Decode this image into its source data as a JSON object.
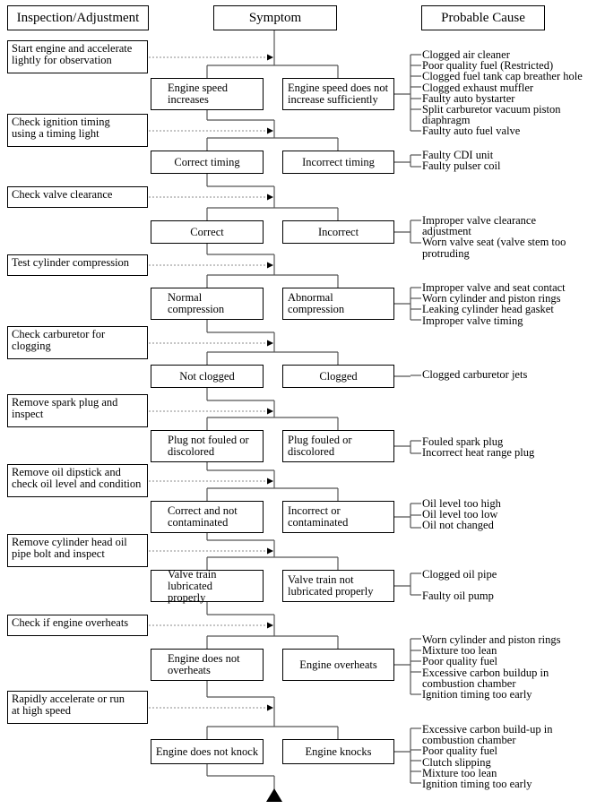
{
  "headers": {
    "inspection": "Inspection/Adjustment",
    "symptom": "Symptom",
    "cause": "Probable Cause"
  },
  "steps": [
    {
      "inspection": "Start engine and accelerate\nlightly for observation",
      "ok": "Engine speed\nincreases",
      "fault": "Engine speed does not\nincrease sufficiently",
      "causes": [
        "Clogged air cleaner",
        "Poor quality fuel (Restricted)",
        "Clogged fuel tank cap breather hole",
        "Clogged exhaust muffler",
        "Faulty auto bystarter",
        "Split carburetor vacuum piston\ndiaphragm",
        "Faulty auto fuel valve"
      ]
    },
    {
      "inspection": "Check ignition timing\nusing a timing light",
      "ok": "Correct timing",
      "fault": "Incorrect timing",
      "causes": [
        "Faulty CDI unit",
        "Faulty pulser coil"
      ]
    },
    {
      "inspection": "Check valve clearance",
      "ok": "Correct",
      "fault": "Incorrect",
      "causes": [
        "Improper valve clearance\nadjustment",
        "Worn valve seat (valve stem too\nprotruding"
      ]
    },
    {
      "inspection": "Test cylinder compression",
      "ok": "Normal\ncompression",
      "fault": "Abnormal\ncompression",
      "causes": [
        "Improper valve and seat contact",
        "Worn cylinder and piston rings",
        "Leaking cylinder head gasket",
        "Improper valve timing"
      ]
    },
    {
      "inspection": "Check carburetor for\nclogging",
      "ok": "Not clogged",
      "fault": "Clogged",
      "causes": [
        "Clogged carburetor jets"
      ]
    },
    {
      "inspection": "Remove spark plug and\ninspect",
      "ok": "Plug not fouled or\ndiscolored",
      "fault": "Plug fouled or\ndiscolored",
      "causes": [
        "Fouled spark plug",
        "Incorrect heat range plug"
      ]
    },
    {
      "inspection": "Remove oil dipstick and\ncheck oil level and condition",
      "ok": "Correct and not\ncontaminated",
      "fault": "Incorrect or\ncontaminated",
      "causes": [
        "Oil level too high",
        "Oil level too low",
        "Oil not changed"
      ]
    },
    {
      "inspection": "Remove cylinder head oil\npipe bolt and inspect",
      "ok": "Valve train lubricated\nproperly",
      "fault": "Valve train not\nlubricated properly",
      "causes": [
        "Clogged oil pipe",
        "Faulty oil pump"
      ]
    },
    {
      "inspection": "Check if engine overheats",
      "ok": "Engine does not\noverheats",
      "fault": "Engine overheats",
      "causes": [
        "Worn cylinder and piston rings",
        "Mixture too lean",
        "Poor quality fuel",
        "Excessive carbon buildup in\ncombustion chamber",
        "Ignition timing too early"
      ]
    },
    {
      "inspection": "Rapidly accelerate or run\nat high speed",
      "ok": "Engine does not knock",
      "fault": "Engine knocks",
      "causes": [
        "Excessive carbon build-up in\ncombustion chamber",
        "Poor quality fuel",
        "Clutch slipping",
        "Mixture too lean",
        "Ignition timing too early"
      ]
    }
  ],
  "continuation": "triangle-continue-icon"
}
